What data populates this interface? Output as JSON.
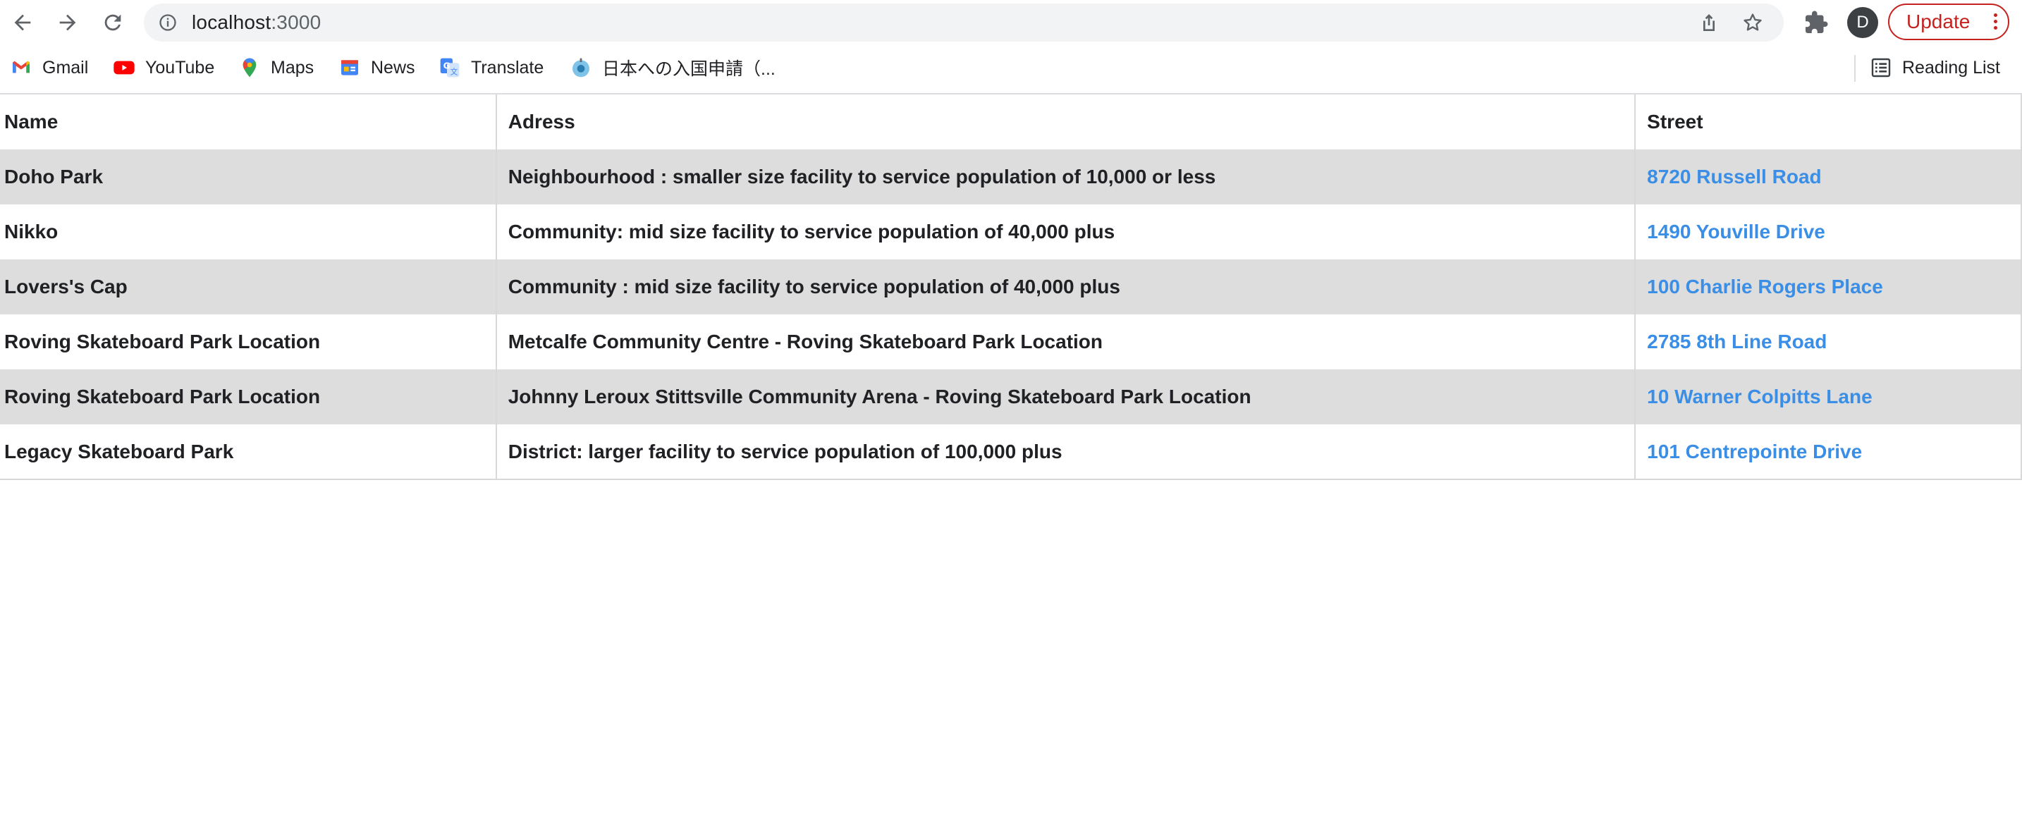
{
  "browser": {
    "url_host": "localhost",
    "url_port": ":3000",
    "avatar_letter": "D",
    "update_label": "Update",
    "accent_color": "#c5221f"
  },
  "bookmarks": [
    {
      "label": "Gmail",
      "icon": "gmail-icon"
    },
    {
      "label": "YouTube",
      "icon": "youtube-icon"
    },
    {
      "label": "Maps",
      "icon": "maps-icon"
    },
    {
      "label": "News",
      "icon": "news-icon"
    },
    {
      "label": "Translate",
      "icon": "translate-icon"
    },
    {
      "label": "日本への入国申請（...",
      "icon": "globe-icon"
    }
  ],
  "reading_list_label": "Reading List",
  "table": {
    "headers": {
      "name": "Name",
      "address": "Adress",
      "street": "Street"
    },
    "rows": [
      {
        "name": "Doho Park",
        "address": "Neighbourhood : smaller size facility to service population of 10,000 or less",
        "street": "8720 Russell Road"
      },
      {
        "name": "Nikko",
        "address": "Community: mid size facility to service population of 40,000 plus",
        "street": "1490 Youville Drive"
      },
      {
        "name": "Lovers's Cap",
        "address": "Community : mid size facility to service population of 40,000 plus",
        "street": "100 Charlie Rogers Place"
      },
      {
        "name": "Roving Skateboard Park Location",
        "address": "Metcalfe Community Centre - Roving Skateboard Park Location",
        "street": "2785 8th Line Road"
      },
      {
        "name": "Roving Skateboard Park Location",
        "address": "Johnny Leroux Stittsville Community Arena - Roving Skateboard Park Location",
        "street": "10 Warner Colpitts Lane"
      },
      {
        "name": "Legacy Skateboard Park",
        "address": "District: larger facility to service population of 100,000 plus",
        "street": "101 Centrepointe Drive"
      }
    ],
    "link_color": "#3a8ee6",
    "stripe_color": "#dddddd"
  }
}
